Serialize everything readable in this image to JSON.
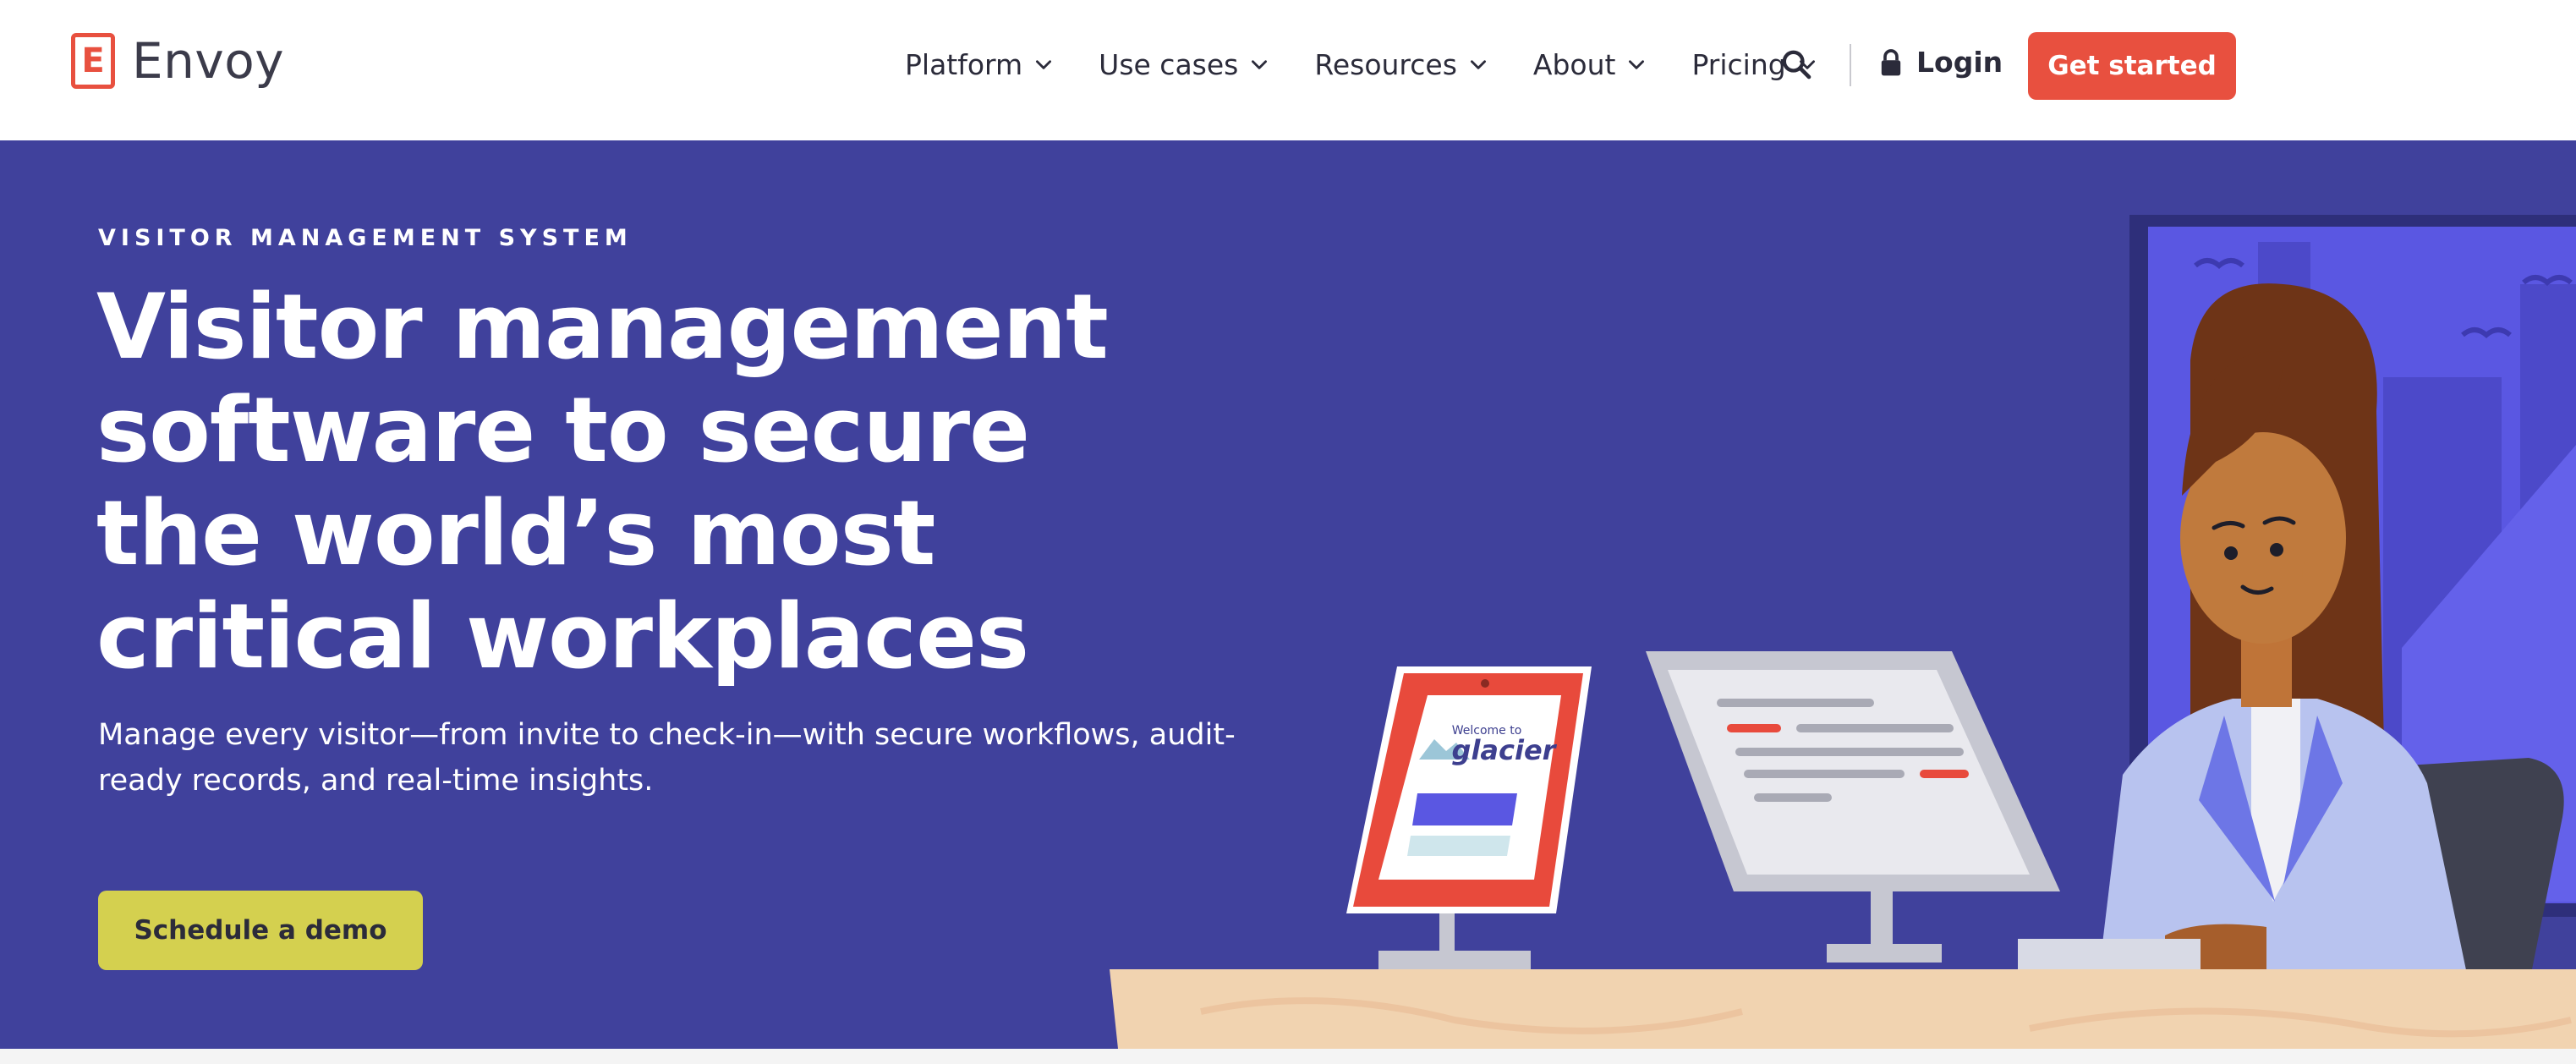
{
  "brand": {
    "name": "Envoy",
    "mark": "E",
    "accent": "#e8503f"
  },
  "nav": {
    "items": [
      {
        "label": "Platform"
      },
      {
        "label": "Use cases"
      },
      {
        "label": "Resources"
      },
      {
        "label": "About"
      },
      {
        "label": "Pricing"
      }
    ],
    "search_icon": "search-icon",
    "login_label": "Login",
    "cta_label": "Get started"
  },
  "hero": {
    "eyebrow": "VISITOR MANAGEMENT SYSTEM",
    "headline": "Visitor management software to secure the world’s most critical workplaces",
    "subtext": "Manage every visitor—from invite to check-in—with secure workflows, audit-ready records, and real-time insights.",
    "cta_label": "Schedule a demo",
    "background": "#40419c",
    "cta_color": "#d4d04f"
  },
  "illustration": {
    "kiosk_welcome": "Welcome to",
    "kiosk_brand": "glacier"
  }
}
